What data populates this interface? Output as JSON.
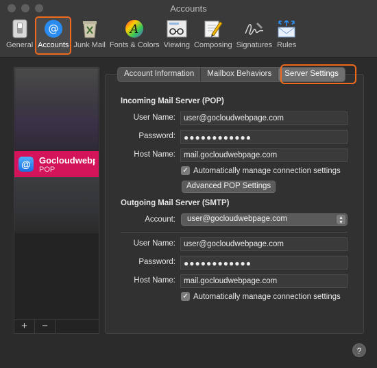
{
  "window": {
    "title": "Accounts"
  },
  "toolbar": {
    "items": [
      {
        "label": "General"
      },
      {
        "label": "Accounts"
      },
      {
        "label": "Junk Mail"
      },
      {
        "label": "Fonts & Colors"
      },
      {
        "label": "Viewing"
      },
      {
        "label": "Composing"
      },
      {
        "label": "Signatures"
      },
      {
        "label": "Rules"
      }
    ]
  },
  "sidebar": {
    "selected_account": {
      "name": "Gocloudwebpage.com",
      "type": "POP"
    },
    "controls": {
      "add": "+",
      "remove": "−"
    }
  },
  "tabs": [
    {
      "label": "Account Information"
    },
    {
      "label": "Mailbox Behaviors"
    },
    {
      "label": "Server Settings"
    }
  ],
  "incoming": {
    "title": "Incoming Mail Server (POP)",
    "username_label": "User Name:",
    "username": "user@gocloudwebpage.com",
    "password_label": "Password:",
    "password": "●●●●●●●●●●●●",
    "host_label": "Host Name:",
    "host": "mail.gocloudwebpage.com",
    "auto_manage": "Automatically manage connection settings",
    "advanced_button": "Advanced POP Settings"
  },
  "outgoing": {
    "title": "Outgoing Mail Server (SMTP)",
    "account_label": "Account:",
    "account": "user@gocloudwebpage.com",
    "username_label": "User Name:",
    "username": "user@gocloudwebpage.com",
    "password_label": "Password:",
    "password": "●●●●●●●●●●●●",
    "host_label": "Host Name:",
    "host": "mail.gocloudwebpage.com",
    "auto_manage": "Automatically manage connection settings"
  },
  "help": "?",
  "colors": {
    "highlight": "#f06a1d",
    "selection": "#d4145a"
  }
}
